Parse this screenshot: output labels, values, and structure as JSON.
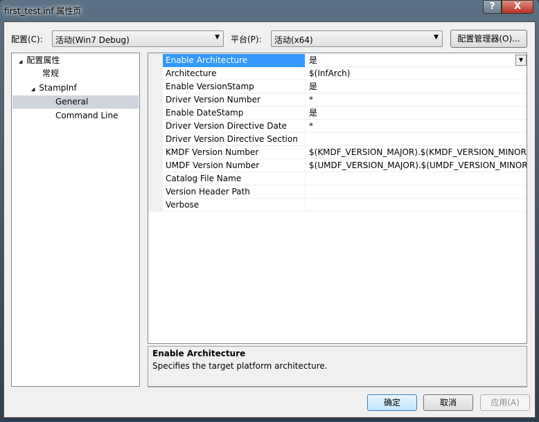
{
  "window": {
    "title": "first_test.inf 属性页",
    "help": "?",
    "close": "X"
  },
  "toolbar": {
    "config_label": "配置(C):",
    "config_value": "活动(Win7 Debug)",
    "platform_label": "平台(P):",
    "platform_value": "活动(x64)",
    "config_manager": "配置管理器(O)..."
  },
  "tree": [
    {
      "label": "配置属性",
      "arrow": "◢"
    },
    {
      "label": "常规"
    },
    {
      "label": "StampInf",
      "arrow": "◢"
    },
    {
      "label": "General",
      "selected": true
    },
    {
      "label": "Command Line"
    }
  ],
  "properties": [
    {
      "name": "Enable Architecture",
      "value": "是"
    },
    {
      "name": "Architecture",
      "value": "$(InfArch)"
    },
    {
      "name": "Enable VersionStamp",
      "value": "是"
    },
    {
      "name": "Driver Version Number",
      "value": "*"
    },
    {
      "name": "Enable DateStamp",
      "value": "是"
    },
    {
      "name": "Driver Version Directive Date",
      "value": "*"
    },
    {
      "name": "Driver Version Directive Section",
      "value": ""
    },
    {
      "name": "KMDF Version Number",
      "value": "$(KMDF_VERSION_MAJOR).$(KMDF_VERSION_MINOR)"
    },
    {
      "name": "UMDF Version Number",
      "value": "$(UMDF_VERSION_MAJOR).$(UMDF_VERSION_MINOR)"
    },
    {
      "name": "Catalog File Name",
      "value": ""
    },
    {
      "name": "Version Header Path",
      "value": ""
    },
    {
      "name": "Verbose",
      "value": ""
    }
  ],
  "description": {
    "title": "Enable Architecture",
    "text": "Specifies the target platform architecture."
  },
  "buttons": {
    "ok": "确定",
    "cancel": "取消",
    "apply": "应用(A)"
  },
  "colors": {
    "selection": "#3399ff",
    "tree_selection": "#cfd3dc"
  }
}
